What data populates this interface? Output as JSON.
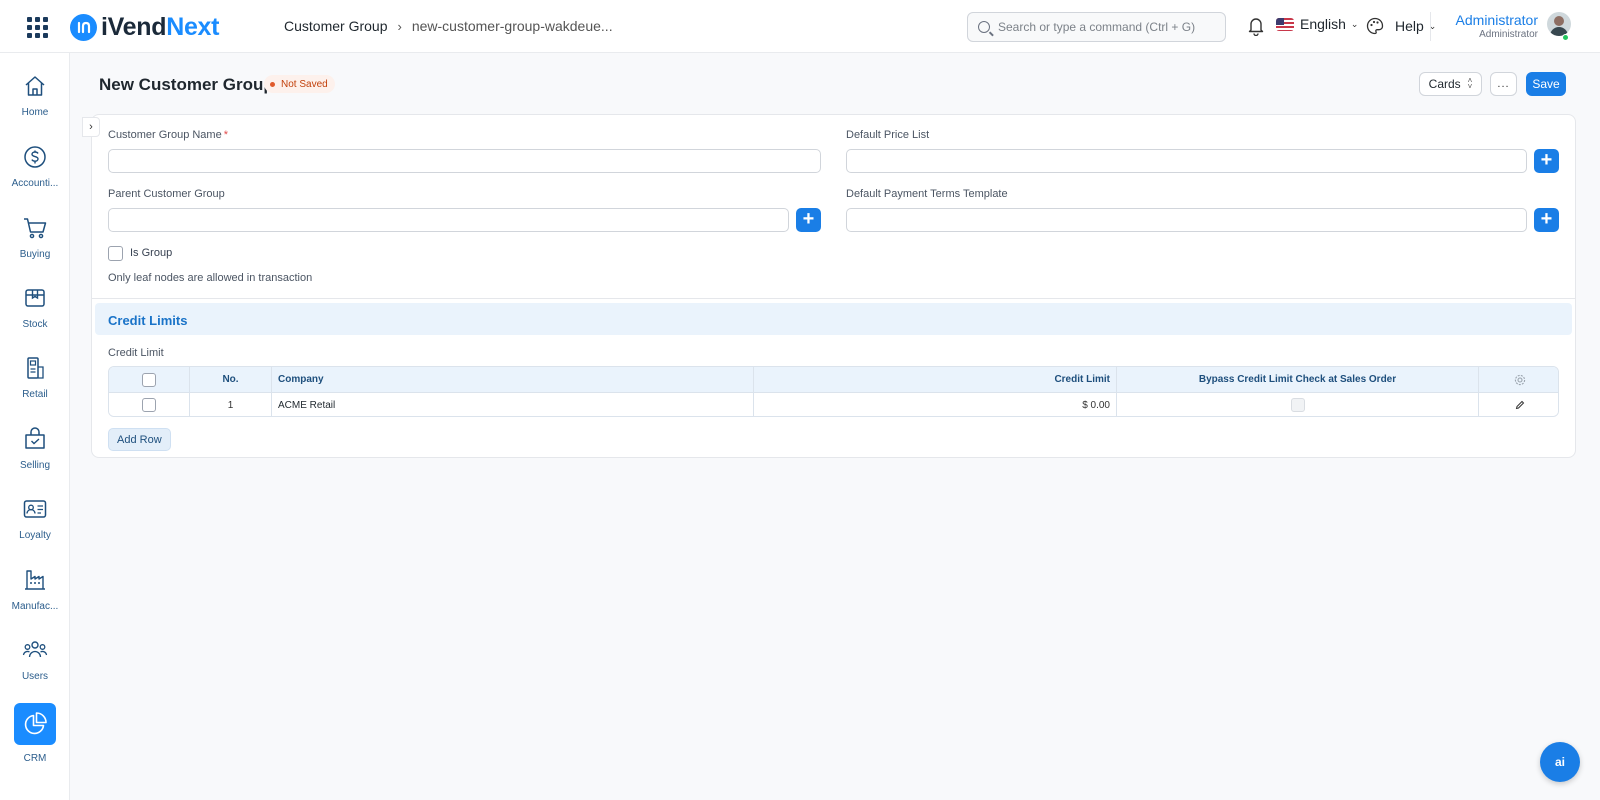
{
  "app": {
    "logo_prefix": "iVend",
    "logo_suffix": "Next"
  },
  "breadcrumb": {
    "parent": "Customer Group",
    "current": "new-customer-group-wakdeue..."
  },
  "search": {
    "placeholder": "Search or type a command (Ctrl + G)"
  },
  "header": {
    "language": "English",
    "help": "Help",
    "user_name": "Administrator",
    "user_role": "Administrator"
  },
  "sidebar": {
    "items": [
      {
        "label": "Home",
        "icon": "home-icon"
      },
      {
        "label": "Accounti...",
        "icon": "dollar-icon"
      },
      {
        "label": "Buying",
        "icon": "cart-icon"
      },
      {
        "label": "Stock",
        "icon": "box-icon"
      },
      {
        "label": "Retail",
        "icon": "store-icon"
      },
      {
        "label": "Selling",
        "icon": "bag-icon"
      },
      {
        "label": "Loyalty",
        "icon": "id-card-icon"
      },
      {
        "label": "Manufac...",
        "icon": "factory-icon"
      },
      {
        "label": "Users",
        "icon": "users-icon"
      },
      {
        "label": "CRM",
        "icon": "pie-chart-icon"
      }
    ],
    "active_index": 9
  },
  "page": {
    "title": "New Customer Group",
    "status": "Not Saved",
    "view_label": "Cards",
    "more_label": "...",
    "save_label": "Save"
  },
  "form": {
    "customer_group_name_label": "Customer Group Name",
    "required_mark": "*",
    "default_price_list_label": "Default Price List",
    "parent_customer_group_label": "Parent Customer Group",
    "default_payment_terms_label": "Default Payment Terms Template",
    "is_group_label": "Is Group",
    "leaf_note": "Only leaf nodes are allowed in transaction",
    "plus": "+"
  },
  "credit_section": {
    "title": "Credit Limits",
    "table_label": "Credit Limit",
    "columns": {
      "no": "No.",
      "company": "Company",
      "credit_limit": "Credit Limit",
      "bypass": "Bypass Credit Limit Check at Sales Order"
    },
    "rows": [
      {
        "no": "1",
        "company": "ACME Retail",
        "credit_limit": "$ 0.00",
        "bypass": false
      }
    ],
    "add_row_label": "Add Row"
  },
  "fab": {
    "label": "ai"
  },
  "colors": {
    "primary": "#1a7ee6",
    "brand": "#1a8cff",
    "section_bg": "#eaf3fc"
  }
}
